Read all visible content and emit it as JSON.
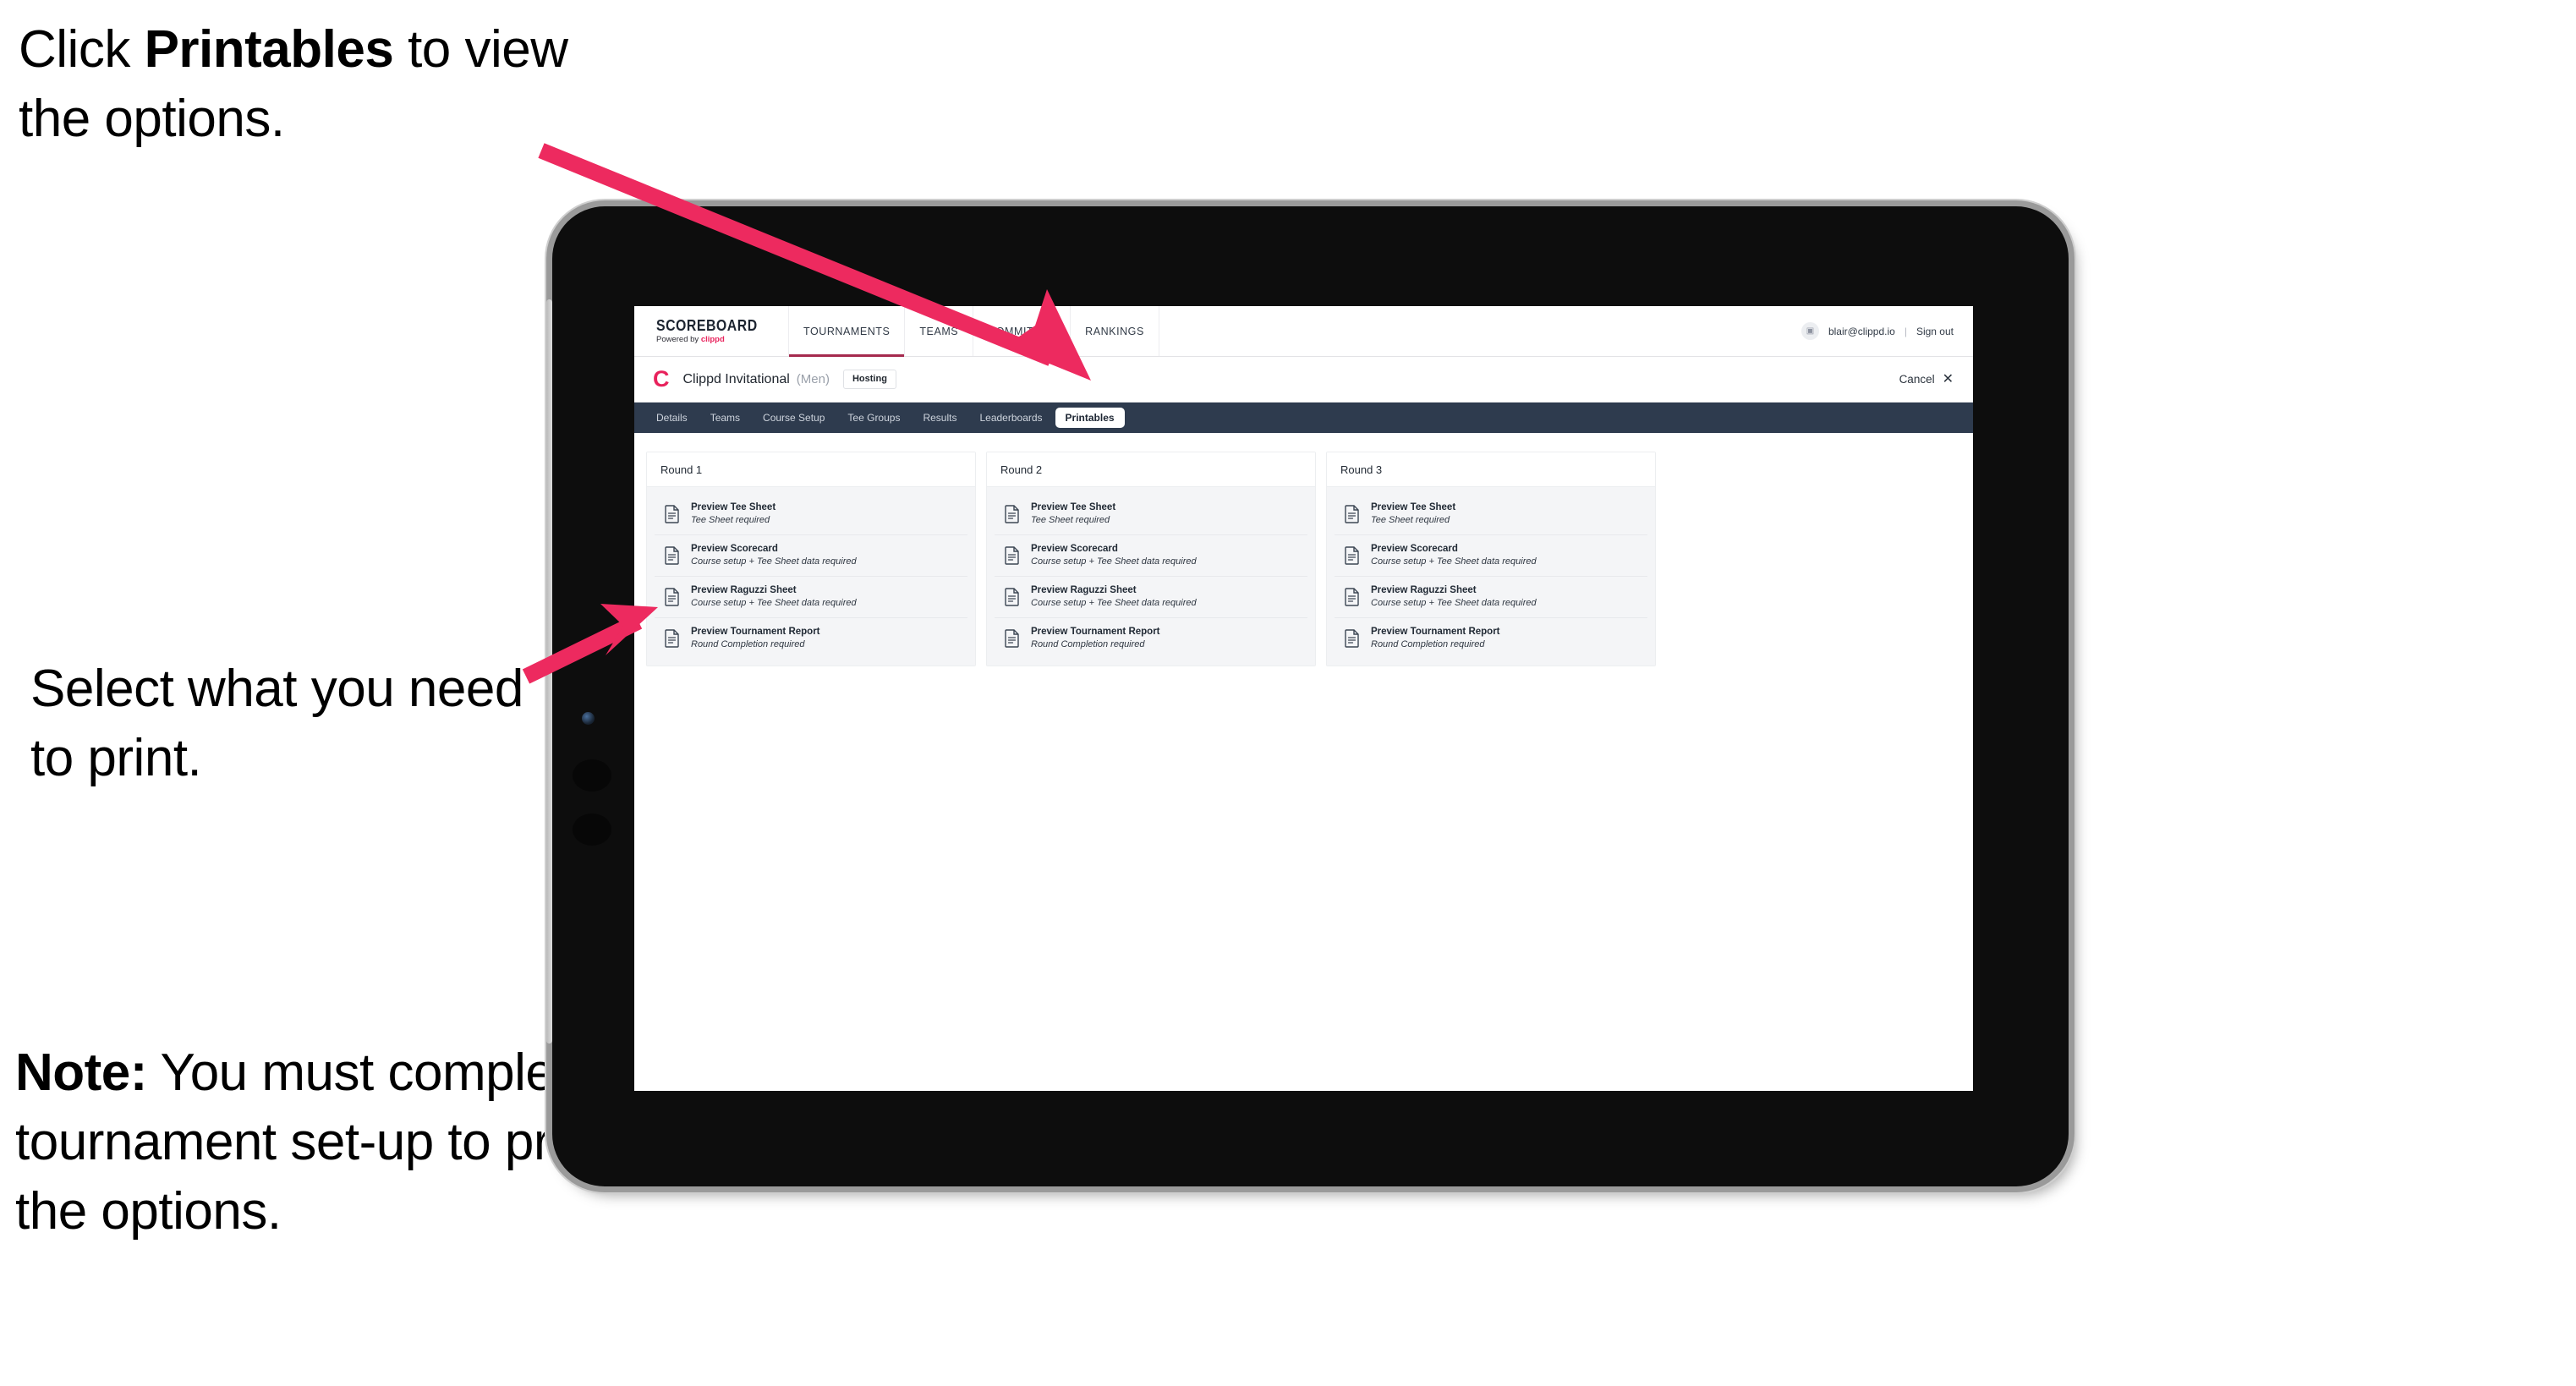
{
  "annotations": {
    "top": {
      "pre": "Click ",
      "bold": "Printables",
      "post": " to view the options."
    },
    "middle": {
      "text": "Select what you need to print."
    },
    "note": {
      "bold": "Note:",
      "text": " You must complete the tournament set-up to print all the options."
    },
    "arrow_color": "#ED2A5F"
  },
  "browser": {
    "global_nav": {
      "brand": {
        "title": "SCOREBOARD",
        "sub_prefix": "Powered by ",
        "sub_brand": "clippd"
      },
      "items": [
        {
          "label": "TOURNAMENTS",
          "active": true
        },
        {
          "label": "TEAMS",
          "active": false
        },
        {
          "label": "COMMITTEE",
          "active": false
        },
        {
          "label": "RANKINGS",
          "active": false
        }
      ],
      "user": {
        "avatar_glyph": "▣",
        "email": "blair@clippd.io",
        "divider": "|",
        "sign_out": "Sign out"
      },
      "active_underline_color": "#A52A4E"
    },
    "tournament_header": {
      "logo_letter": "C",
      "name": "Clippd Invitational",
      "gender": "(Men)",
      "badge": "Hosting",
      "cancel_label": "Cancel",
      "cancel_icon": "✕"
    },
    "section_tabs": [
      {
        "label": "Details",
        "active": false
      },
      {
        "label": "Teams",
        "active": false
      },
      {
        "label": "Course Setup",
        "active": false
      },
      {
        "label": "Tee Groups",
        "active": false
      },
      {
        "label": "Results",
        "active": false
      },
      {
        "label": "Leaderboards",
        "active": false
      },
      {
        "label": "Printables",
        "active": true
      }
    ],
    "rounds": [
      {
        "title": "Round 1",
        "items": [
          {
            "title": "Preview Tee Sheet",
            "sub": "Tee Sheet required"
          },
          {
            "title": "Preview Scorecard",
            "sub": "Course setup + Tee Sheet data required"
          },
          {
            "title": "Preview Raguzzi Sheet",
            "sub": "Course setup + Tee Sheet data required"
          },
          {
            "title": "Preview Tournament Report",
            "sub": "Round Completion required"
          }
        ]
      },
      {
        "title": "Round 2",
        "items": [
          {
            "title": "Preview Tee Sheet",
            "sub": "Tee Sheet required"
          },
          {
            "title": "Preview Scorecard",
            "sub": "Course setup + Tee Sheet data required"
          },
          {
            "title": "Preview Raguzzi Sheet",
            "sub": "Course setup + Tee Sheet data required"
          },
          {
            "title": "Preview Tournament Report",
            "sub": "Round Completion required"
          }
        ]
      },
      {
        "title": "Round 3",
        "items": [
          {
            "title": "Preview Tee Sheet",
            "sub": "Tee Sheet required"
          },
          {
            "title": "Preview Scorecard",
            "sub": "Course setup + Tee Sheet data required"
          },
          {
            "title": "Preview Raguzzi Sheet",
            "sub": "Course setup + Tee Sheet data required"
          },
          {
            "title": "Preview Tournament Report",
            "sub": "Round Completion required"
          }
        ]
      }
    ]
  }
}
